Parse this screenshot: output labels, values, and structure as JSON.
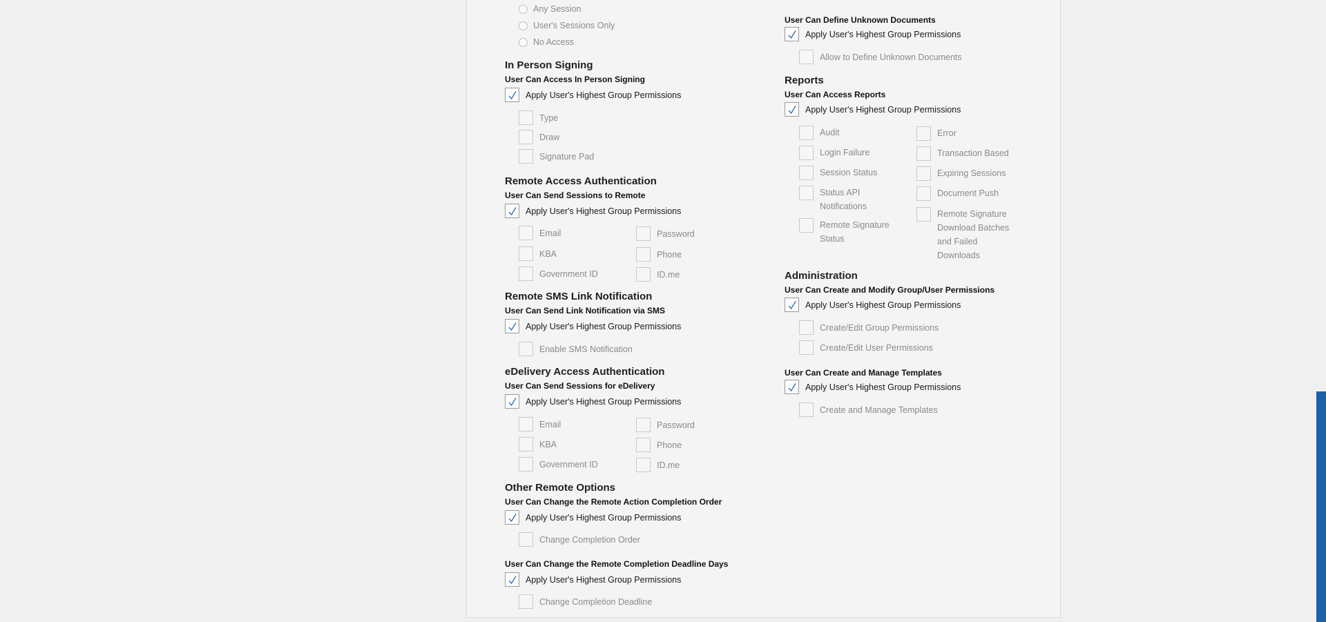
{
  "apply_label": "Apply User's Highest Group Permissions",
  "session_access": {
    "options": [
      "Any Session",
      "User's Sessions Only",
      "No Access"
    ]
  },
  "in_person": {
    "title": "In Person Signing",
    "subtitle": "User Can Access In Person Signing",
    "options": [
      "Type",
      "Draw",
      "Signature Pad"
    ]
  },
  "remote_auth": {
    "title": "Remote Access Authentication",
    "subtitle": "User Can Send Sessions to Remote",
    "col1": [
      "Email",
      "KBA",
      "Government ID"
    ],
    "col2": [
      "Password",
      "Phone",
      "ID.me"
    ]
  },
  "sms": {
    "title": "Remote SMS Link Notification",
    "subtitle": "User Can Send Link Notification via SMS",
    "options": [
      "Enable SMS Notification"
    ]
  },
  "edelivery": {
    "title": "eDelivery Access Authentication",
    "subtitle": "User Can Send Sessions for eDelivery",
    "col1": [
      "Email",
      "KBA",
      "Government ID"
    ],
    "col2": [
      "Password",
      "Phone",
      "ID.me"
    ]
  },
  "other_remote": {
    "title": "Other Remote Options",
    "order_subtitle": "User Can Change the Remote Action Completion Order",
    "order_option": "Change Completion Order",
    "deadline_subtitle": "User Can Change the Remote Completion Deadline Days",
    "deadline_option": "Change Completion Deadline"
  },
  "unknown_docs": {
    "subtitle": "User Can Define Unknown Documents",
    "option": "Allow to Define Unknown Documents"
  },
  "reports": {
    "title": "Reports",
    "subtitle": "User Can Access Reports",
    "col1": [
      "Audit",
      "Login Failure",
      "Session Status",
      "Status API Notifications",
      "Remote Signature Status"
    ],
    "col2": [
      "Error",
      "Transaction Based",
      "Expiring Sessions",
      "Document Push",
      "Remote Signature Download Batches and Failed Downloads"
    ]
  },
  "administration": {
    "title": "Administration",
    "subtitle": "User Can Create and Modify Group/User Permissions",
    "options": [
      "Create/Edit Group Permissions",
      "Create/Edit User Permissions"
    ]
  },
  "templates": {
    "subtitle": "User Can Create and Manage Templates",
    "option": "Create and Manage Templates"
  },
  "icons": {
    "check": "check-icon"
  },
  "colors": {
    "accent": "#1b61a6",
    "check": "#2b6cb0"
  }
}
